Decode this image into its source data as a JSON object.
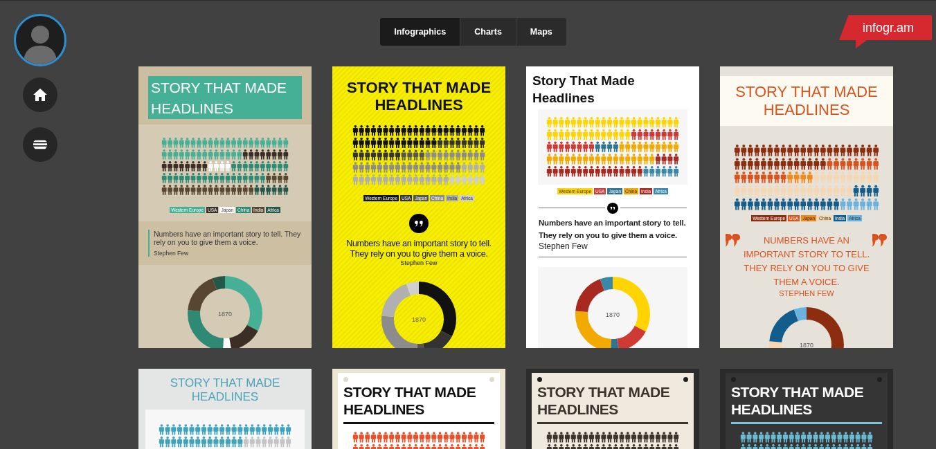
{
  "tabs": [
    {
      "label": "Infographics",
      "selected": true
    },
    {
      "label": "Charts",
      "selected": false
    },
    {
      "label": "Maps",
      "selected": false
    }
  ],
  "logo": "infogr.am",
  "cards": [
    {
      "kind": "sand",
      "title": "STORY THAT MADE HEADLINES",
      "legend": [
        {
          "label": "Western Europe",
          "color": "#45b096"
        },
        {
          "label": "USA",
          "color": "#3b2e25"
        },
        {
          "label": "Japan",
          "color": "#ffffff"
        },
        {
          "label": "China",
          "color": "#2e8a74"
        },
        {
          "label": "India",
          "color": "#574630"
        },
        {
          "label": "Africa",
          "color": "#24574a"
        }
      ],
      "quote": "Numbers have an important story to tell. They rely on you to give them a voice.",
      "author": "Stephen Few",
      "donut_label": "1870"
    },
    {
      "kind": "yellow",
      "title": "STORY THAT MADE HEADLINES",
      "legend": [
        {
          "label": "Western Europe",
          "color": "#111111"
        },
        {
          "label": "USA",
          "color": "#333333"
        },
        {
          "label": "Japan",
          "color": "#555555"
        },
        {
          "label": "China",
          "color": "#8c8c8c"
        },
        {
          "label": "India",
          "color": "#b0b0b0"
        },
        {
          "label": "Africa",
          "color": "#cfcfcf"
        }
      ],
      "quote": "Numbers have an important story to tell. They rely on you to give them a voice.",
      "author": "Stephen Few",
      "donut_label": "1870"
    },
    {
      "kind": "white",
      "title": "Story That Made Headlines",
      "legend": [
        {
          "label": "Western Europe",
          "color": "#ffd400"
        },
        {
          "label": "USA",
          "color": "#d03a35"
        },
        {
          "label": "Japan",
          "color": "#2e7591"
        },
        {
          "label": "China",
          "color": "#f2a900"
        },
        {
          "label": "India",
          "color": "#a8291f"
        },
        {
          "label": "Africa",
          "color": "#3b87a8"
        }
      ],
      "quote": "Numbers have an important story to tell. They rely on you to give them a voice.",
      "author": "Stephen Few",
      "donut_label": "1870"
    },
    {
      "kind": "cream",
      "title": "STORY THAT MADE HEADLINES",
      "legend": [
        {
          "label": "Western Europe",
          "color": "#8b2d0e"
        },
        {
          "label": "USA",
          "color": "#d9531e"
        },
        {
          "label": "Japan",
          "color": "#f08a1c"
        },
        {
          "label": "China",
          "color": "#f5d7b4"
        },
        {
          "label": "India",
          "color": "#125d8b"
        },
        {
          "label": "Africa",
          "color": "#6ab3df"
        }
      ],
      "quote": "NUMBERS HAVE AN IMPORTANT STORY TO TELL. THEY RELY ON YOU TO GIVE THEM A VOICE.",
      "author": "STEPHEN FEW",
      "donut_label": "1870"
    },
    {
      "kind": "mist",
      "title": "STORY THAT MADE HEADLINES",
      "series": [
        {
          "color": "#3ea3bd"
        },
        {
          "color": "#c4c4c4"
        }
      ]
    },
    {
      "kind": "paper",
      "title": "STORY THAT MADE HEADLINES",
      "series": [
        {
          "color": "#e8512a"
        }
      ]
    },
    {
      "kind": "beige",
      "title": "STORY THAT MADE HEADLINES",
      "series": [
        {
          "color": "#3a342d"
        }
      ]
    },
    {
      "kind": "dark",
      "title": "STORY THAT MADE HEADLINES",
      "series": [
        {
          "color": "#6bbad3"
        }
      ]
    }
  ]
}
